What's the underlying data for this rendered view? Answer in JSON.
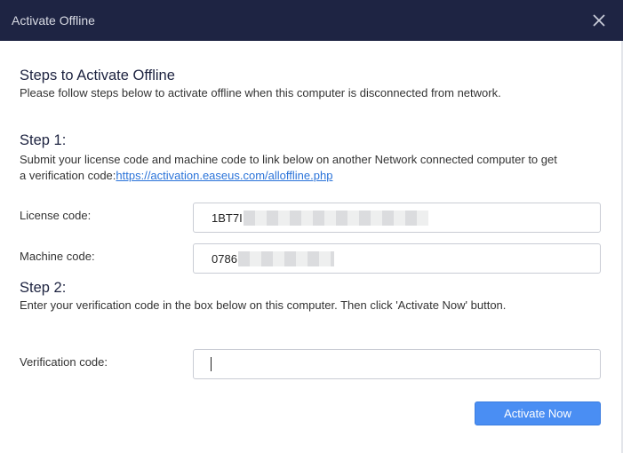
{
  "window": {
    "title": "Activate Offline",
    "close_icon": "close-icon"
  },
  "intro": {
    "heading": "Steps to Activate Offline",
    "description": "Please follow steps below to activate offline when this computer is disconnected from network."
  },
  "step1": {
    "title": "Step 1:",
    "text_line1": "Submit your license code and machine code to link below on another Network connected computer to get",
    "text_line2_prefix": "a verification code:",
    "link_text": "https://activation.easeus.com/alloffline.php"
  },
  "license": {
    "label": "License code:",
    "value_visible": "1BT7I"
  },
  "machine": {
    "label": "Machine code:",
    "value_visible": "0786"
  },
  "step2": {
    "title": "Step 2:",
    "text": "Enter your verification code in the box below on this computer. Then click 'Activate Now' button."
  },
  "verification": {
    "label": "Verification code:",
    "value": ""
  },
  "actions": {
    "activate_label": "Activate Now"
  },
  "colors": {
    "titlebar": "#1e2443",
    "accent": "#4a8ef3",
    "link": "#2a73d9"
  }
}
